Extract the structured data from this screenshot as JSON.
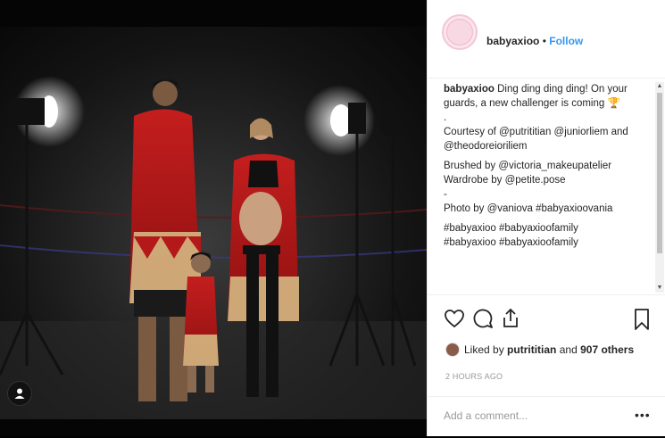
{
  "post": {
    "username": "babyaxioo",
    "separator": "•",
    "follow_label": "Follow"
  },
  "caption": {
    "username": "babyaxioo",
    "lines": [
      "Ding ding ding ding! On your",
      "guards, a new challenger is coming 🏆",
      ".",
      "Courtesy of @putrititian @juniorliem and",
      "@theodoreioriliem",
      "",
      "Brushed by @victoria_makeupatelier",
      "Wardrobe by @petite.pose",
      "-",
      "Photo by @vaniova #babyaxioovania",
      "",
      "#babyaxioo #babyaxioofamily",
      "#babyaxioo #babyaxioofamily"
    ]
  },
  "likes": {
    "prefix": "Liked by",
    "user": "putrititian",
    "middle": "and",
    "count": "907 others"
  },
  "timestamp": "2 HOURS AGO",
  "comment": {
    "placeholder": "Add a comment..."
  },
  "more_label": "•••",
  "icons": {
    "like": "heart-icon",
    "comment": "comment-icon",
    "share": "share-icon",
    "save": "bookmark-icon",
    "user_tag": "person-icon"
  },
  "colors": {
    "link": "#3897f0",
    "text": "#262626",
    "muted": "#999999"
  }
}
